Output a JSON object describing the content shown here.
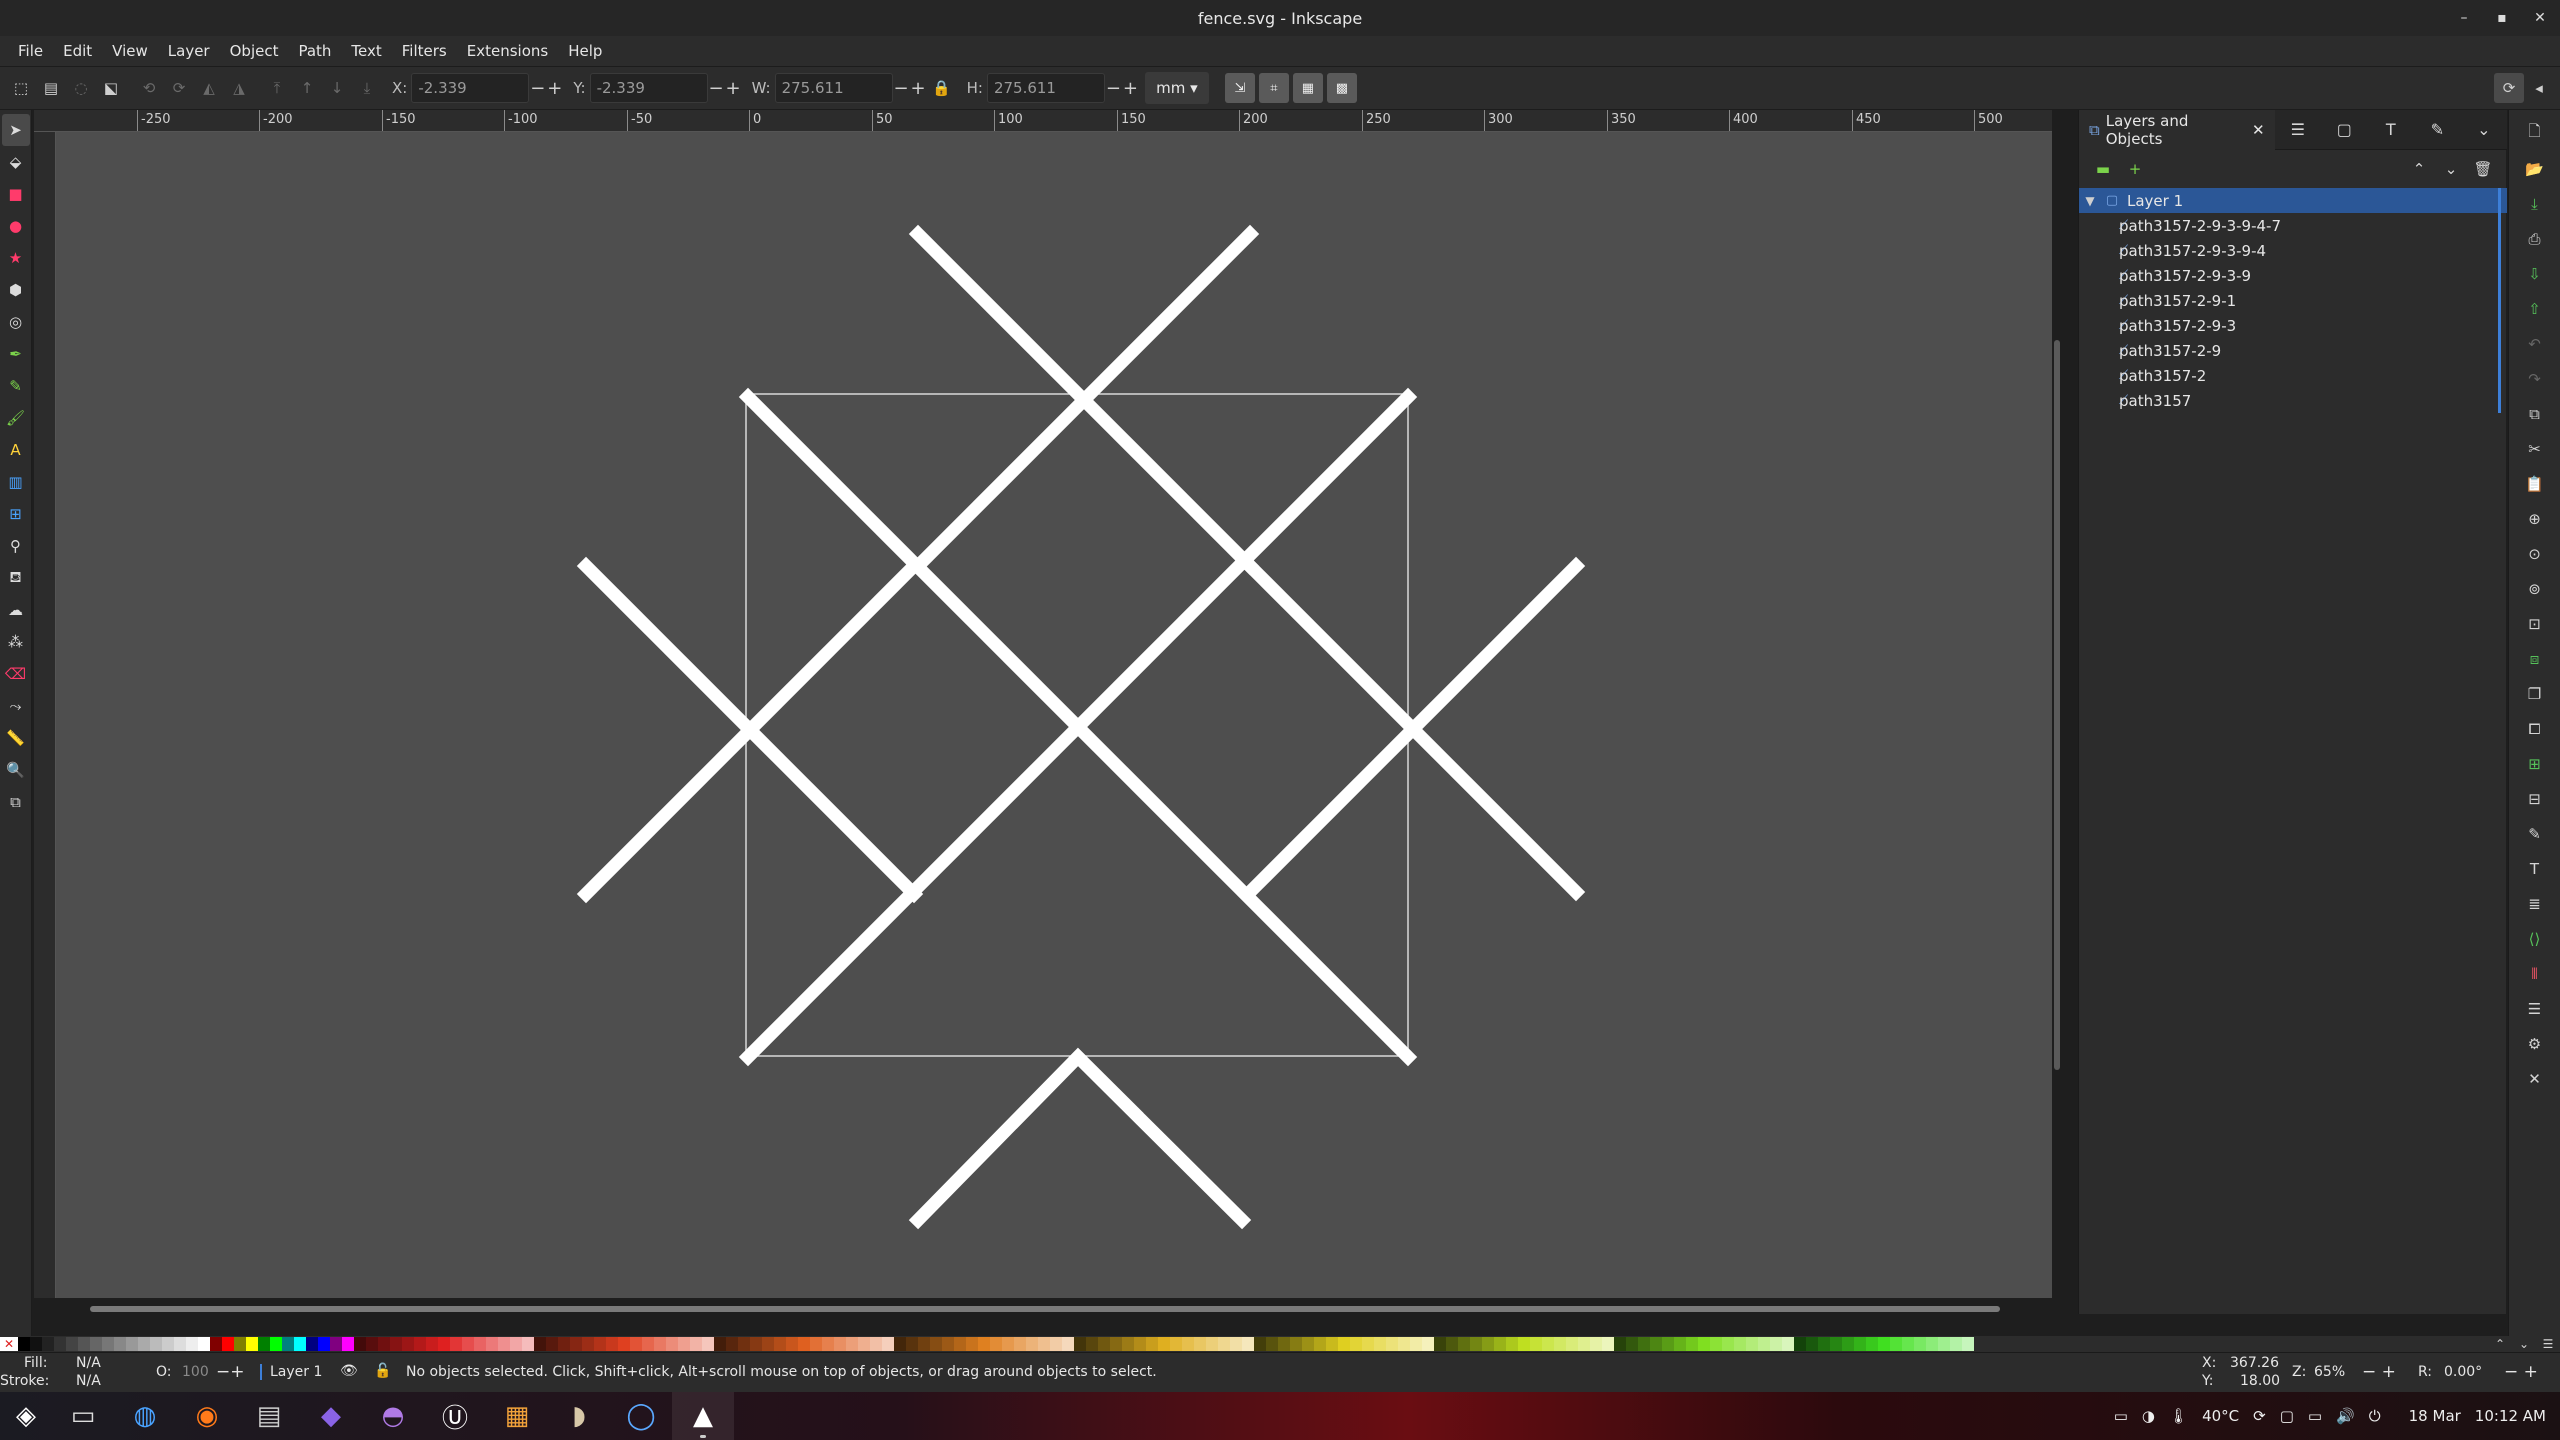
{
  "window": {
    "title": "fence.svg - Inkscape"
  },
  "menu": [
    "File",
    "Edit",
    "View",
    "Layer",
    "Object",
    "Path",
    "Text",
    "Filters",
    "Extensions",
    "Help"
  ],
  "toolctl": {
    "x_label": "X:",
    "x_value": "-2.339",
    "y_label": "Y:",
    "y_value": "-2.339",
    "w_label": "W:",
    "w_value": "275.611",
    "h_label": "H:",
    "h_value": "275.611",
    "unit": "mm"
  },
  "ruler": {
    "h_ticks": [
      "-250",
      "-200",
      "-150",
      "-100",
      "-50",
      "0",
      "50",
      "100",
      "150",
      "200",
      "250",
      "300",
      "350",
      "400",
      "450",
      "500"
    ]
  },
  "panel": {
    "tab_label": "Layers and Objects",
    "layer_name": "Layer 1",
    "objects": [
      "path3157-2-9-3-9-4-7",
      "path3157-2-9-3-9-4",
      "path3157-2-9-3-9",
      "path3157-2-9-1",
      "path3157-2-9-3",
      "path3157-2-9",
      "path3157-2",
      "path3157"
    ]
  },
  "status": {
    "fill_label": "Fill:",
    "fill_value": "N/A",
    "stroke_label": "Stroke:",
    "stroke_value": "N/A",
    "opacity_label": "O:",
    "opacity_value": "100",
    "layer": "Layer 1",
    "message": "No objects selected. Click, Shift+click, Alt+scroll mouse on top of objects, or drag around objects to select.",
    "cursor_x_label": "X:",
    "cursor_x": "367.26",
    "cursor_y_label": "Y:",
    "cursor_y": "18.00",
    "zoom_label": "Z:",
    "zoom": "65%",
    "rotate_label": "R:",
    "rotate": "0.00°"
  },
  "taskbar": {
    "temperature": "40°C",
    "date": "18 Mar",
    "time": "10:12 AM"
  },
  "colors": {
    "canvas": "#4e4e4e",
    "selection": "#2b5797",
    "panel": "#2c2c2c",
    "stroke": "#ffffff"
  }
}
